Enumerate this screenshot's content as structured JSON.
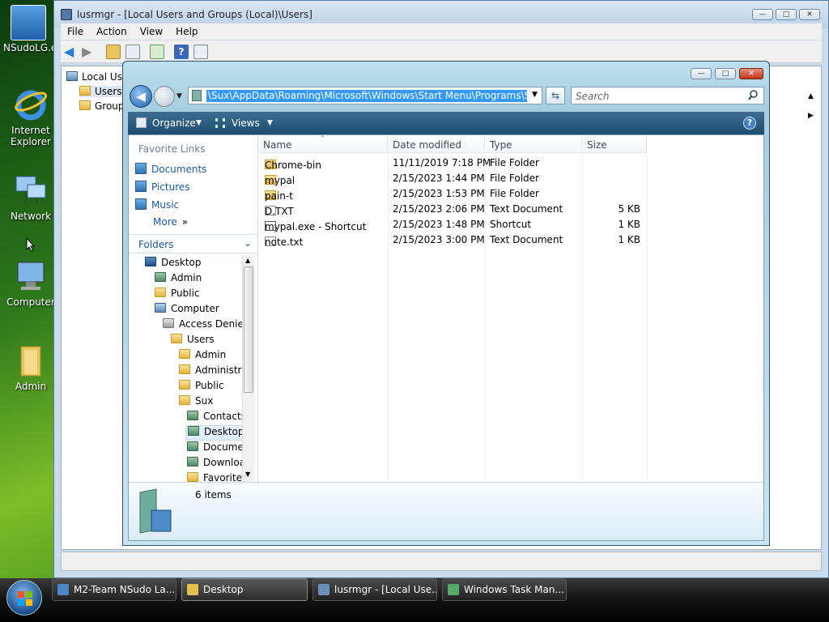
{
  "desktop": {
    "icons": [
      {
        "label": "NSudoLG.exe"
      },
      {
        "label": "Internet Explorer"
      },
      {
        "label": "Network"
      },
      {
        "label": "Computer"
      },
      {
        "label": "Admin"
      }
    ]
  },
  "lusrmgr": {
    "title": "lusrmgr - [Local Users and Groups (Local)\\Users]",
    "menu": [
      "File",
      "Action",
      "View",
      "Help"
    ],
    "tree": [
      "Local Users and Groups",
      "Users",
      "Groups"
    ]
  },
  "explorer": {
    "address": "\\Sux\\AppData\\Roaming\\Microsoft\\Windows\\Start Menu\\Programs\\Startup",
    "search_placeholder": "Search",
    "organize_label": "Organize",
    "views_label": "Views",
    "favorite_links_title": "Favorite Links",
    "favorite_links": [
      "Documents",
      "Pictures",
      "Music"
    ],
    "more_label": "More",
    "folders_label": "Folders",
    "folder_tree": [
      {
        "label": "Desktop",
        "icon": "desktop-icon"
      },
      {
        "label": "Admin",
        "icon": "user-folder-icon"
      },
      {
        "label": "Public",
        "icon": "folder-icon"
      },
      {
        "label": "Computer",
        "icon": "computer-icon"
      },
      {
        "label": "Access Denied",
        "icon": "drive-icon"
      },
      {
        "label": "Users",
        "icon": "folder-icon"
      },
      {
        "label": "Admin",
        "icon": "folder-icon"
      },
      {
        "label": "Administra",
        "icon": "folder-icon"
      },
      {
        "label": "Public",
        "icon": "folder-icon"
      },
      {
        "label": "Sux",
        "icon": "folder-icon"
      },
      {
        "label": "Contacts",
        "icon": "special-folder-icon"
      },
      {
        "label": "Desktop",
        "icon": "special-folder-icon"
      },
      {
        "label": "Documen",
        "icon": "special-folder-icon"
      },
      {
        "label": "Downloa",
        "icon": "special-folder-icon"
      },
      {
        "label": "Favorites",
        "icon": "special-folder-icon"
      }
    ],
    "columns": [
      "Name",
      "Date modified",
      "Type",
      "Size"
    ],
    "files": [
      {
        "name": "Chrome-bin",
        "date": "11/11/2019 7:18 PM",
        "type": "File Folder",
        "size": "",
        "icon": "folder-icon"
      },
      {
        "name": "mypal",
        "date": "2/15/2023 1:44 PM",
        "type": "File Folder",
        "size": "",
        "icon": "folder-icon"
      },
      {
        "name": "pain-t",
        "date": "2/15/2023 1:53 PM",
        "type": "File Folder",
        "size": "",
        "icon": "folder-icon"
      },
      {
        "name": "D.TXT",
        "date": "2/15/2023 2:06 PM",
        "type": "Text Document",
        "size": "5 KB",
        "icon": "text-file-icon"
      },
      {
        "name": "mypal.exe - Shortcut",
        "date": "2/15/2023 1:48 PM",
        "type": "Shortcut",
        "size": "1 KB",
        "icon": "shortcut-icon"
      },
      {
        "name": "note.txt",
        "date": "2/15/2023 3:00 PM",
        "type": "Text Document",
        "size": "1 KB",
        "icon": "text-file-icon"
      }
    ],
    "item_count": "6 items"
  },
  "taskbar": {
    "buttons": [
      {
        "label": "M2-Team NSudo La..."
      },
      {
        "label": "Desktop"
      },
      {
        "label": "lusrmgr - [Local Use..."
      },
      {
        "label": "Windows Task Man..."
      }
    ]
  },
  "colors": {
    "selection": "#3399ff",
    "link": "#1a58a8",
    "command_bar": "#1e4c6e"
  }
}
